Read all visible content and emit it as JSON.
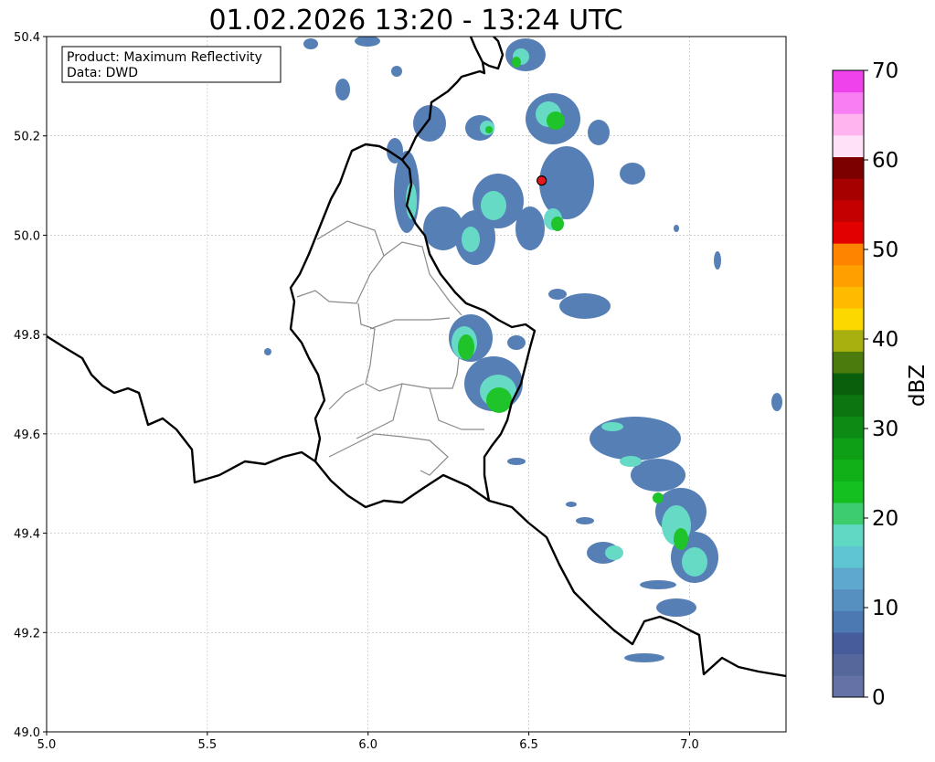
{
  "title": "01.02.2026 13:20 - 13:24 UTC",
  "info_box": {
    "product_line": "Product: Maximum Reflectivity",
    "data_line": "Data: DWD"
  },
  "map": {
    "lon_range": [
      5.0,
      7.3
    ],
    "lat_range": [
      49.0,
      50.4
    ],
    "x_ticks": [
      "5.0",
      "5.5",
      "6.0",
      "6.5",
      "7.0"
    ],
    "y_ticks": [
      "49.0",
      "49.2",
      "49.4",
      "49.6",
      "49.8",
      "50.0",
      "50.2",
      "50.4"
    ],
    "grid": true,
    "marker": {
      "lon": 6.54,
      "lat": 50.11,
      "color": "#e8171b"
    }
  },
  "colorbar": {
    "label": "dBZ",
    "range": [
      0,
      70
    ],
    "ticks": [
      "0",
      "10",
      "20",
      "30",
      "40",
      "50",
      "60",
      "70"
    ],
    "colors": [
      "#6472a6",
      "#56679c",
      "#465c9b",
      "#4d79b2",
      "#5590c0",
      "#5ea8cd",
      "#5fc5d3",
      "#5fd9c3",
      "#3ecd6e",
      "#14c01f",
      "#10b019",
      "#0e9f16",
      "#0d8a14",
      "#0c7510",
      "#0a5f0c",
      "#4b7a0d",
      "#a7b00e",
      "#fdd700",
      "#ffbb00",
      "#ffa000",
      "#fe8400",
      "#e20000",
      "#c40000",
      "#a60000",
      "#7d0000",
      "#ffe2f8",
      "#ffb4f0",
      "#f97df3",
      "#ef42ed"
    ]
  }
}
